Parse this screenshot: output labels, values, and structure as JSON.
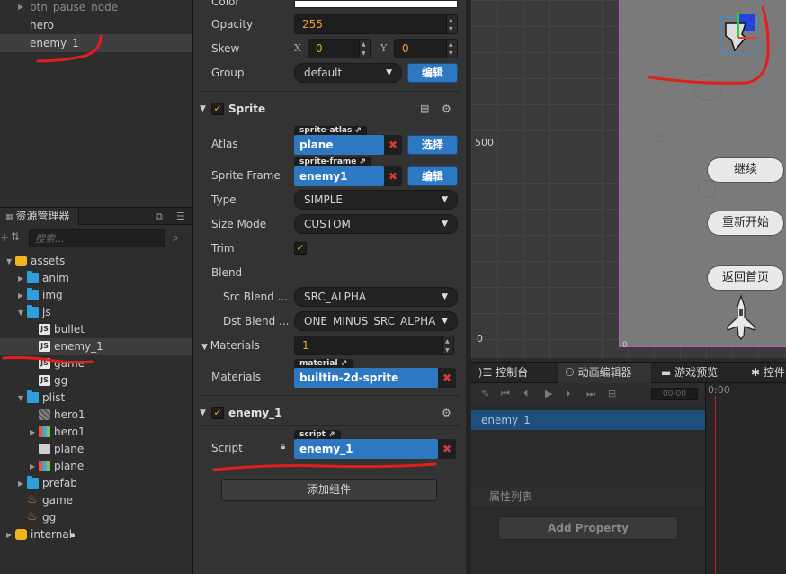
{
  "hierarchy": {
    "items": [
      {
        "label": "btn_pause_node",
        "dim": true,
        "caret": true
      },
      {
        "label": "hero",
        "dim": false,
        "caret": false
      },
      {
        "label": "enemy_1",
        "dim": false,
        "caret": false,
        "selected": true
      }
    ]
  },
  "assets": {
    "tab_label": "资源管理器",
    "search_placeholder": "搜索...",
    "tree": [
      {
        "label": "assets",
        "icon": "database-icon",
        "depth": 0,
        "caret": "down"
      },
      {
        "label": "anim",
        "icon": "folder-icon",
        "depth": 1,
        "caret": "right"
      },
      {
        "label": "img",
        "icon": "folder-icon",
        "depth": 1,
        "caret": "right"
      },
      {
        "label": "js",
        "icon": "folder-icon",
        "depth": 1,
        "caret": "down"
      },
      {
        "label": "bullet",
        "icon": "js-file-icon",
        "depth": 2
      },
      {
        "label": "enemy_1",
        "icon": "js-file-icon",
        "depth": 2,
        "selected": true
      },
      {
        "label": "game",
        "icon": "js-file-icon",
        "depth": 2
      },
      {
        "label": "gg",
        "icon": "js-file-icon",
        "depth": 2
      },
      {
        "label": "plist",
        "icon": "folder-icon",
        "depth": 1,
        "caret": "down"
      },
      {
        "label": "hero1",
        "icon": "plist-icon",
        "depth": 2
      },
      {
        "label": "hero1",
        "icon": "sprite-atlas-icon",
        "depth": 2,
        "caret": "right"
      },
      {
        "label": "plane",
        "icon": "plist-file-icon",
        "depth": 2
      },
      {
        "label": "plane",
        "icon": "sprite-atlas-icon",
        "depth": 2,
        "caret": "right"
      },
      {
        "label": "prefab",
        "icon": "folder-icon",
        "depth": 1,
        "caret": "right"
      },
      {
        "label": "game",
        "icon": "scene-fire-icon",
        "depth": 1
      },
      {
        "label": "gg",
        "icon": "scene-fire-icon",
        "depth": 1
      },
      {
        "label": "internal",
        "icon": "database-icon",
        "depth": 0,
        "caret": "right",
        "locked": true
      }
    ]
  },
  "inspector": {
    "color_label": "Color",
    "opacity_label": "Opacity",
    "opacity_value": "255",
    "skew_label": "Skew",
    "skew_x_label": "X",
    "skew_x_value": "0",
    "skew_y_label": "Y",
    "skew_y_value": "0",
    "group_label": "Group",
    "group_value": "default",
    "group_edit": "编辑",
    "sprite_section": "Sprite",
    "atlas_label": "Atlas",
    "atlas_tag": "sprite-atlas",
    "atlas_value": "plane",
    "atlas_select": "选择",
    "frame_label": "Sprite Frame",
    "frame_tag": "sprite-frame",
    "frame_value": "enemy1",
    "frame_edit": "编辑",
    "type_label": "Type",
    "type_value": "SIMPLE",
    "sizemode_label": "Size Mode",
    "sizemode_value": "CUSTOM",
    "trim_label": "Trim",
    "blend_label": "Blend",
    "src_blend_label": "Src Blend ...",
    "src_blend_value": "SRC_ALPHA",
    "dst_blend_label": "Dst Blend ...",
    "dst_blend_value": "ONE_MINUS_SRC_ALPHA",
    "materials_label": "Materials",
    "materials_count": "1",
    "material_item_label": "Materials",
    "material_tag": "material",
    "material_value": "builtin-2d-sprite",
    "enemy_section": "enemy_1",
    "script_label": "Script",
    "script_tag": "script",
    "script_value": "enemy_1",
    "add_component": "添加组件"
  },
  "scene": {
    "axis_label_500": "500",
    "axis_label_0": "0",
    "axis_label_0b": "0",
    "buttons": [
      "继续",
      "重新开始",
      "返回首页"
    ]
  },
  "dock": {
    "tabs": [
      "控制台",
      "动画编辑器",
      "游戏预览",
      "控件"
    ],
    "time_value": "00-00",
    "time_label": "0:00",
    "node_name": "enemy_1",
    "property_list": "属性列表",
    "add_property": "Add Property"
  },
  "colors": {
    "accent_blue": "#2e78c2",
    "orange": "#f0a030",
    "annotation_red": "#e0201f"
  }
}
